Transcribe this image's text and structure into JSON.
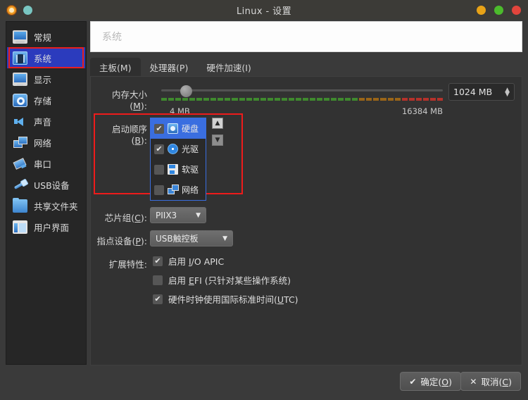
{
  "window": {
    "title": "Linux - 设置",
    "app_icon": "virtualbox-app-icon",
    "status_icon": "status-dot-icon",
    "controls": [
      {
        "name": "minimize-button",
        "color": "#e8a317"
      },
      {
        "name": "maximize-button",
        "color": "#4cbb2c"
      },
      {
        "name": "close-button",
        "color": "#e2453c"
      }
    ]
  },
  "sidebar": {
    "items": [
      {
        "label": "常规",
        "icon": "monitor-icon",
        "selected": false
      },
      {
        "label": "系统",
        "icon": "chip-icon",
        "selected": true
      },
      {
        "label": "显示",
        "icon": "display-icon",
        "selected": false
      },
      {
        "label": "存储",
        "icon": "harddisk-icon",
        "selected": false
      },
      {
        "label": "声音",
        "icon": "speaker-icon",
        "selected": false
      },
      {
        "label": "网络",
        "icon": "network-icon",
        "selected": false
      },
      {
        "label": "串口",
        "icon": "serial-port-icon",
        "selected": false
      },
      {
        "label": "USB设备",
        "icon": "usb-icon",
        "selected": false
      },
      {
        "label": "共享文件夹",
        "icon": "folder-icon",
        "selected": false
      },
      {
        "label": "用户界面",
        "icon": "user-interface-icon",
        "selected": false
      }
    ],
    "selected_highlight_color": "#2b3bbd",
    "annotation_color": "#e81f1f"
  },
  "panel": {
    "header_title": "系统",
    "tabs": [
      {
        "label": "主板(M)",
        "accel": "M",
        "active": true
      },
      {
        "label": "处理器(P)",
        "accel": "P",
        "active": false
      },
      {
        "label": "硬件加速(I)",
        "accel": "I",
        "active": false
      }
    ]
  },
  "memory": {
    "label": "内存大小(M):",
    "label_text": "内存大小(",
    "label_accel": "M",
    "label_tail": "):",
    "min_label": "4 MB",
    "max_label": "16384 MB",
    "value": "1024 MB",
    "min_mb": 4,
    "max_mb": 16384,
    "current_mb": 1024,
    "slider_percent": 7
  },
  "boot_order": {
    "label_text": "启动顺序(",
    "label_accel": "B",
    "label_tail": "):",
    "items": [
      {
        "label": "硬盘",
        "icon": "harddisk-icon",
        "checked": true,
        "selected": true
      },
      {
        "label": "光驱",
        "icon": "optical-disc-icon",
        "checked": true,
        "selected": false
      },
      {
        "label": "软驱",
        "icon": "floppy-icon",
        "checked": false,
        "selected": false
      },
      {
        "label": "网络",
        "icon": "network-icon",
        "checked": false,
        "selected": false
      }
    ],
    "move_up": "▲",
    "move_down": "▼"
  },
  "chipset": {
    "label_text": "芯片组(",
    "label_accel": "C",
    "label_tail": "):",
    "value": "PIIX3"
  },
  "pointing_device": {
    "label_text": "指点设备(",
    "label_accel": "P",
    "label_tail": "):",
    "value": "USB触控板"
  },
  "extended_features": {
    "label": "扩展特性:",
    "items": [
      {
        "prefix": "启用 ",
        "accel": "I",
        "suffix": "/O APIC",
        "checked": true,
        "name": "io-apic"
      },
      {
        "prefix": "启用 ",
        "accel": "E",
        "suffix": "FI (只针对某些操作系统)",
        "checked": false,
        "name": "efi"
      },
      {
        "prefix": "硬件时钟使用国际标准时间(",
        "accel": "U",
        "suffix": "TC)",
        "checked": true,
        "name": "utc"
      }
    ]
  },
  "footer": {
    "ok": {
      "glyph": "✔",
      "prefix": "确定(",
      "accel": "O",
      "suffix": ")"
    },
    "cancel": {
      "glyph": "✕",
      "prefix": "取消(",
      "accel": "C",
      "suffix": ")"
    }
  }
}
